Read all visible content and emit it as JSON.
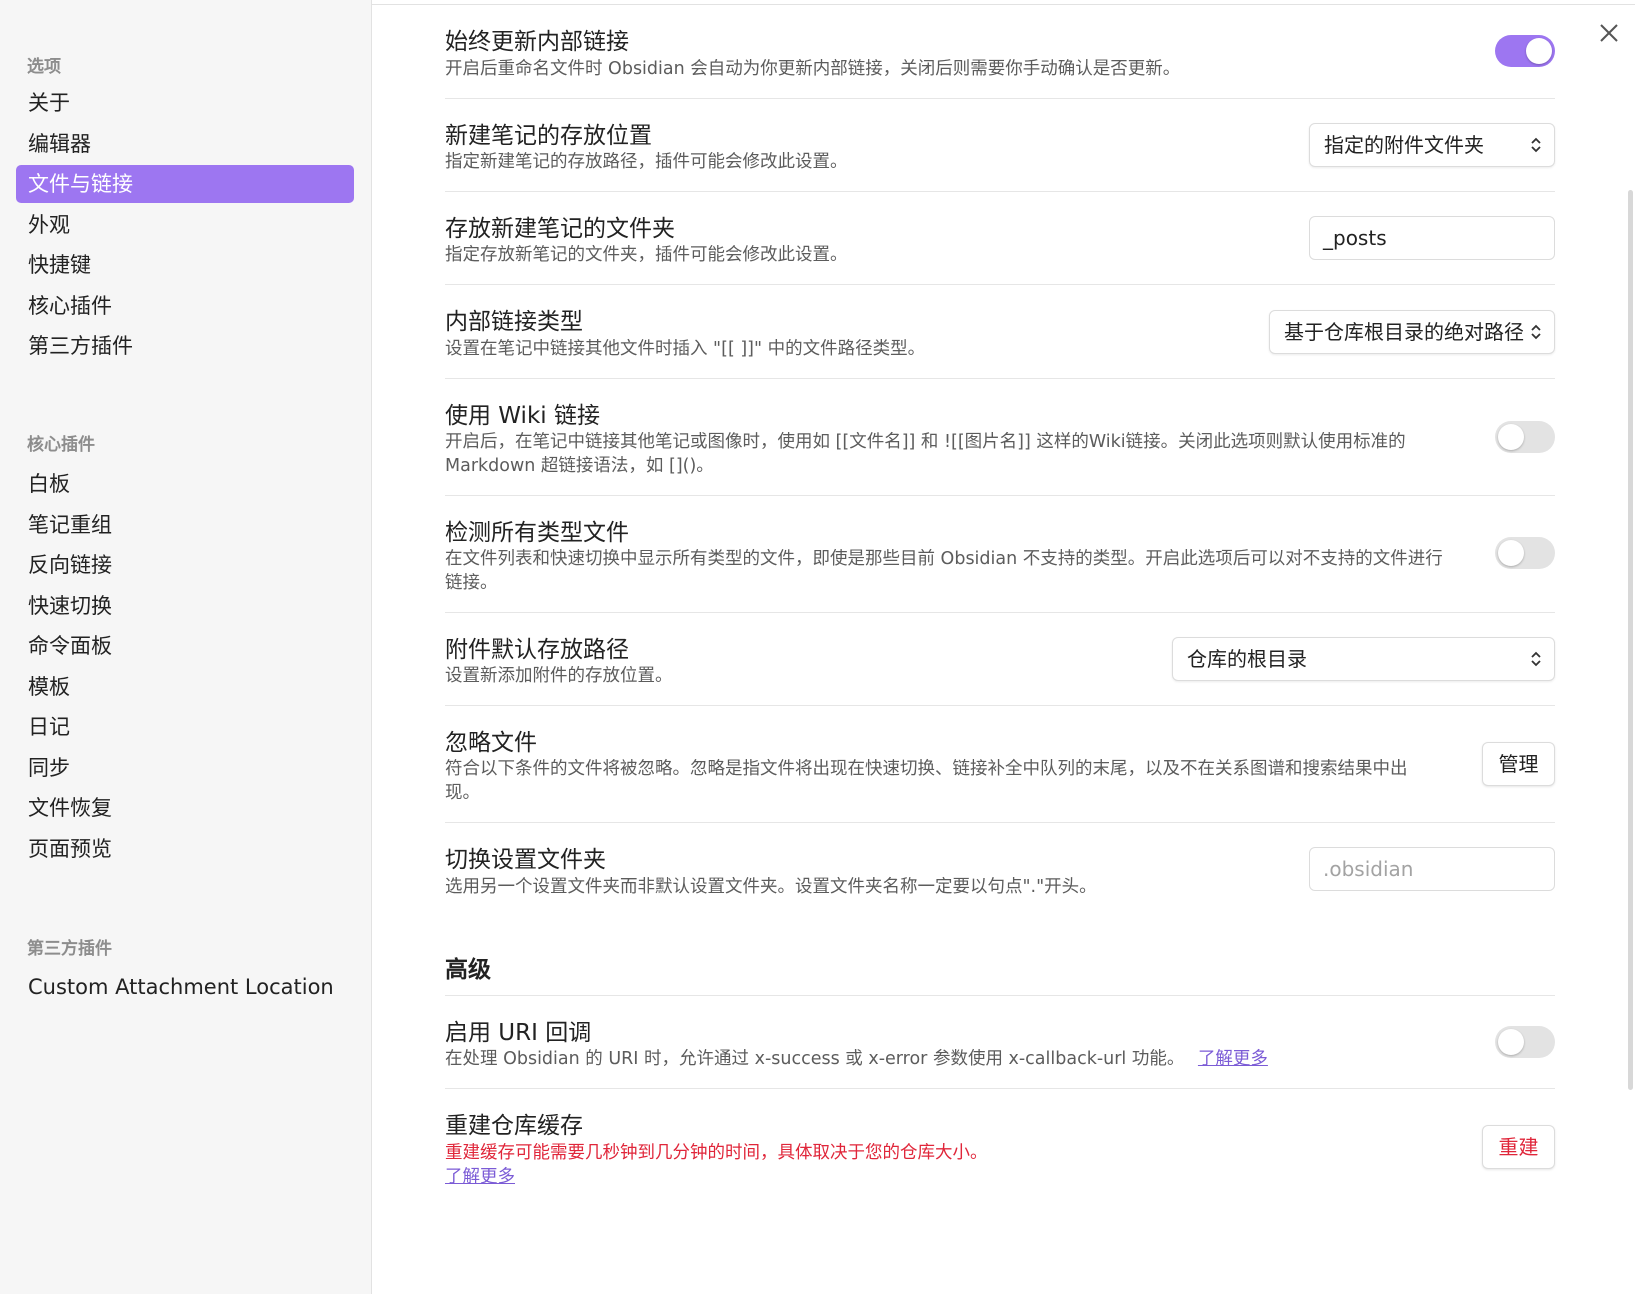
{
  "sidebar": {
    "groups": [
      {
        "title": "选项",
        "items": [
          {
            "label": "关于",
            "active": false
          },
          {
            "label": "编辑器",
            "active": false
          },
          {
            "label": "文件与链接",
            "active": true
          },
          {
            "label": "外观",
            "active": false
          },
          {
            "label": "快捷键",
            "active": false
          },
          {
            "label": "核心插件",
            "active": false
          },
          {
            "label": "第三方插件",
            "active": false
          }
        ]
      },
      {
        "title": "核心插件",
        "items": [
          {
            "label": "白板"
          },
          {
            "label": "笔记重组"
          },
          {
            "label": "反向链接"
          },
          {
            "label": "快速切换"
          },
          {
            "label": "命令面板"
          },
          {
            "label": "模板"
          },
          {
            "label": "日记"
          },
          {
            "label": "同步"
          },
          {
            "label": "文件恢复"
          },
          {
            "label": "页面预览"
          }
        ]
      },
      {
        "title": "第三方插件",
        "items": [
          {
            "label": "Custom Attachment Location"
          }
        ]
      }
    ]
  },
  "close_icon": "close-icon",
  "accent_color": "#9d76f1",
  "settings": [
    {
      "title": "始终更新内部链接",
      "desc": "开启后重命名文件时 Obsidian 会自动为你更新内部链接，关闭后则需要你手动确认是否更新。",
      "control": "toggle",
      "on": true
    },
    {
      "title": "新建笔记的存放位置",
      "desc": "指定新建笔记的存放路径，插件可能会修改此设置。",
      "control": "select",
      "value": "指定的附件文件夹"
    },
    {
      "title": "存放新建笔记的文件夹",
      "desc": "指定存放新笔记的文件夹，插件可能会修改此设置。",
      "control": "input",
      "value": "_posts"
    },
    {
      "title": "内部链接类型",
      "desc": "设置在笔记中链接其他文件时插入 \"[[ ]]\" 中的文件路径类型。",
      "control": "select",
      "value": "基于仓库根目录的绝对路径"
    },
    {
      "title": "使用 Wiki 链接",
      "desc1": "开启后，在笔记中链接其他笔记或图像时，使用如 [[文件名]] 和 ![[图片名]] 这样的Wiki链接。关闭此选项则默认使用标准的",
      "desc2": "Markdown 超链接语法，如 []()。",
      "control": "toggle",
      "on": false
    },
    {
      "title": "检测所有类型文件",
      "desc1": "在文件列表和快速切换中显示所有类型的文件，即使是那些目前 Obsidian 不支持的类型。开启此选项后可以对不支持的文件进行",
      "desc2": "链接。",
      "control": "toggle",
      "on": false
    },
    {
      "title": "附件默认存放路径",
      "desc": "设置新添加附件的存放位置。",
      "control": "select",
      "value": "仓库的根目录"
    },
    {
      "title": "忽略文件",
      "desc1": "符合以下条件的文件将被忽略。忽略是指文件将出现在快速切换、链接补全中队列的末尾，以及不在关系图谱和搜索结果中出",
      "desc2": "现。",
      "control": "button",
      "button_label": "管理"
    },
    {
      "title": "切换设置文件夹",
      "desc": "选用另一个设置文件夹而非默认设置文件夹。设置文件夹名称一定要以句点\".\"开头。",
      "control": "input",
      "placeholder": ".obsidian"
    }
  ],
  "advanced": {
    "heading": "高级",
    "uri": {
      "title": "启用 URI 回调",
      "desc": "在处理 Obsidian 的 URI 时，允许通过 x-success 或 x-error 参数使用 x-callback-url 功能。",
      "link": "了解更多",
      "on": false
    },
    "rebuild": {
      "title": "重建仓库缓存",
      "desc": "重建缓存可能需要几秒钟到几分钟的时间，具体取决于您的仓库大小。",
      "link": "了解更多",
      "button_label": "重建"
    }
  }
}
